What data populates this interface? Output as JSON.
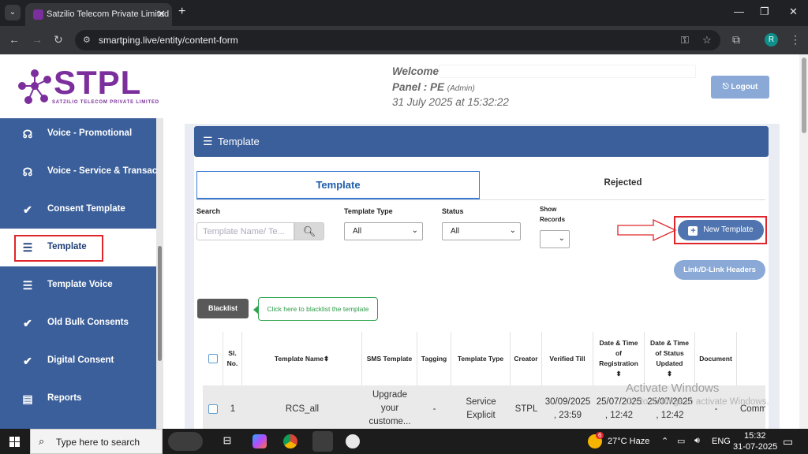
{
  "browser": {
    "tab_title": "Satzilio Telecom Private Limited",
    "tab_close": "✕",
    "new_tab": "+",
    "url": "smartping.live/entity/content-form",
    "profile_initial": "R"
  },
  "logo": {
    "text": "STPL",
    "subtitle": "SATZILIO TELECOM PRIVATE LIMITED"
  },
  "sidebar": {
    "items": [
      {
        "label": "Voice - Promotional",
        "icon": "voice-icon"
      },
      {
        "label": "Voice - Service & Transac",
        "icon": "voice-icon"
      },
      {
        "label": "Consent Template",
        "icon": "check-circle-icon"
      },
      {
        "label": "Template",
        "icon": "list-icon"
      },
      {
        "label": "Template Voice",
        "icon": "list-icon"
      },
      {
        "label": "Old Bulk Consents",
        "icon": "check-circle-icon"
      },
      {
        "label": "Digital Consent",
        "icon": "check-circle-icon"
      },
      {
        "label": "Reports",
        "icon": "clipboard-icon"
      }
    ],
    "active_index": 3
  },
  "header": {
    "welcome": "Welcome,",
    "panel": "Panel : PE",
    "panel_role": "(Admin)",
    "datetime": "31 July 2025 at 15:32:22",
    "logout_label": "Logout"
  },
  "panel": {
    "title": "Template",
    "tabs": [
      "Template",
      "Rejected"
    ]
  },
  "filters": {
    "search_label": "Search",
    "search_placeholder": "Template Name/ Te...",
    "template_type_label": "Template Type",
    "template_type_value": "All",
    "status_label": "Status",
    "status_value": "All",
    "show_records_label_1": "Show",
    "show_records_label_2": "Records",
    "show_records_value": ""
  },
  "buttons": {
    "new_template": "New Template",
    "link_headers": "Link/D-Link Headers",
    "blacklist": "Blacklist",
    "blacklist_tip": "Click here to blacklist the template"
  },
  "table": {
    "headers": [
      "",
      "Sl. No.",
      "Template Name",
      "SMS Template",
      "Tagging",
      "Template Type",
      "Creator",
      "Verified Till",
      "Date & Time of Registration",
      "Date & Time of Status Updated",
      "Document",
      ""
    ],
    "rows": [
      [
        "",
        "1",
        "RCS_all",
        "Upgrade your custome...",
        "-",
        "Service Explicit",
        "STPL",
        "30/09/2025 , 23:59",
        "25/07/2025 , 12:42",
        "25/07/2025 , 12:42",
        "-",
        "Comm"
      ]
    ]
  },
  "watermark": {
    "line1": "Activate Windows",
    "line2": "Go to Settings to activate Windows."
  },
  "taskbar": {
    "search_placeholder": "Type here to search",
    "weather": "27°C  Haze",
    "language": "ENG",
    "time": "15:32",
    "date": "31-07-2025",
    "notification_count": "6"
  }
}
